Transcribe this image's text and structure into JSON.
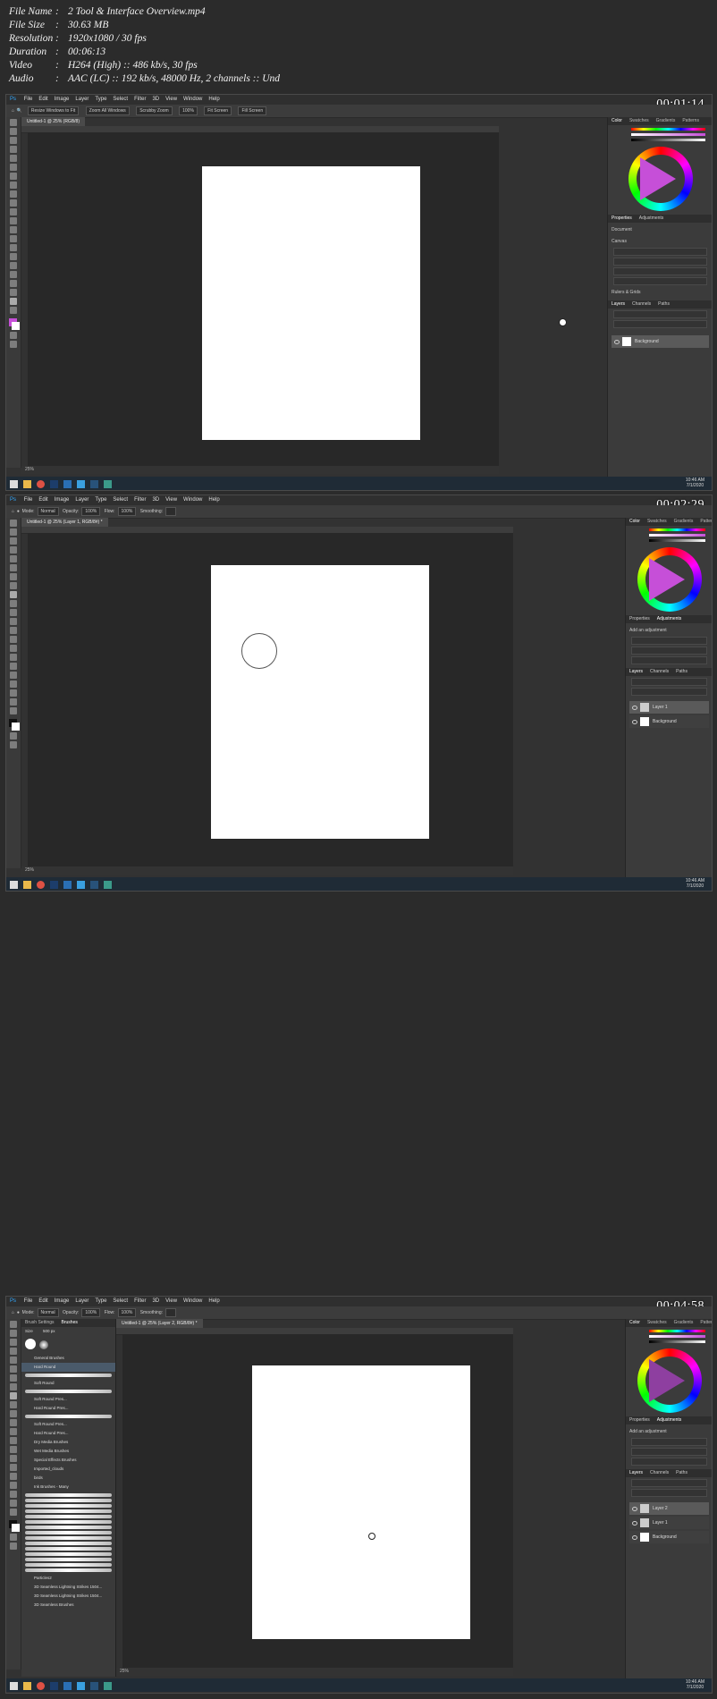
{
  "file_info": {
    "rows": [
      {
        "key": "File Name",
        "sep": ":",
        "value": "2 Tool & Interface Overview.mp4"
      },
      {
        "key": "File Size",
        "sep": ":",
        "value": "30.63 MB"
      },
      {
        "key": "Resolution",
        "sep": ":",
        "value": "1920x1080 / 30 fps"
      },
      {
        "key": "Duration",
        "sep": ":",
        "value": "00:06:13"
      },
      {
        "key": "Video",
        "sep": ":",
        "value": "H264 (High) :: 486 kb/s, 30 fps"
      },
      {
        "key": "Audio",
        "sep": ":",
        "value": "AAC (LC) :: 192 kb/s, 48000 Hz, 2 channels :: Und"
      }
    ]
  },
  "frames": [
    {
      "timecode": "00:01:14",
      "doc_tab": "Untitled-1 @ 25% (RGB/8)",
      "status": "25%",
      "options": [
        "Resize Windows to Fit",
        "Zoom All Windows",
        "Scrubby Zoom",
        "100%",
        "Fit Screen",
        "Fill Screen"
      ]
    },
    {
      "timecode": "00:02:29",
      "doc_tab": "Untitled-1 @ 25% (Layer 1, RGB/8#) *",
      "status": "25%",
      "options": [
        "Mode:",
        "Normal",
        "Opacity:",
        "100%",
        "Flow:",
        "100%",
        "Smoothing:"
      ]
    },
    {
      "timecode": "00:04:58",
      "doc_tab": "Untitled-1 @ 25% (Layer 2, RGB/8#) *",
      "status": "25%",
      "options": [
        "Mode:",
        "Normal",
        "Opacity:",
        "100%",
        "Flow:",
        "100%",
        "Smoothing:"
      ]
    }
  ],
  "menu": [
    "File",
    "Edit",
    "Image",
    "Layer",
    "Type",
    "Select",
    "Filter",
    "3D",
    "View",
    "Window",
    "Help"
  ],
  "panels": {
    "color_tabs": [
      "Color",
      "Swatches",
      "Gradients",
      "Patterns"
    ],
    "props_tabs_1": [
      "Properties",
      "Adjustments"
    ],
    "props_tabs_2": [
      "Properties",
      "Adjustments"
    ],
    "layers_tabs": [
      "Layers",
      "Channels",
      "Paths"
    ],
    "document_label": "Document",
    "canvas_label": "Canvas",
    "rulers_label": "Rulers & Grids",
    "add_adjustment": "Add an adjustment",
    "blend_mode": "Normal",
    "opacity_label": "Opacity:",
    "opacity": "100%"
  },
  "layers": {
    "frame1": [
      "Background"
    ],
    "frame2": [
      "Layer 1",
      "Background"
    ],
    "frame3": [
      "Layer 2",
      "Layer 1",
      "Background"
    ]
  },
  "brush_panel": {
    "tabs": [
      "Brush Settings",
      "Brushes"
    ],
    "size_label": "Size",
    "size": "500 px",
    "groups": [
      "General Brushes",
      "Dry Media Brushes",
      "Wet Media Brushes",
      "Special Effects Brushes",
      "Imported_clouds",
      "birds",
      "Ink Brushes - Many"
    ],
    "brushes": [
      "Hard Round",
      "Soft Round",
      "Soft Round Pres...",
      "Hard Round Pres...",
      "Soft Round Pres...",
      "Hard Round Pres..."
    ],
    "bottom": [
      "Particles2",
      "3D Seamless Lightning Strikes 1504...",
      "3D Seamless Lightning Strikes 1504...",
      "3D Seamless Brushes"
    ]
  },
  "taskbar": {
    "time": "10:46 AM",
    "date": "7/1/2020"
  },
  "colors": {
    "accent_fg": "#c64fd8",
    "canvas_bg": "#282828",
    "ui_bg": "#323232"
  }
}
